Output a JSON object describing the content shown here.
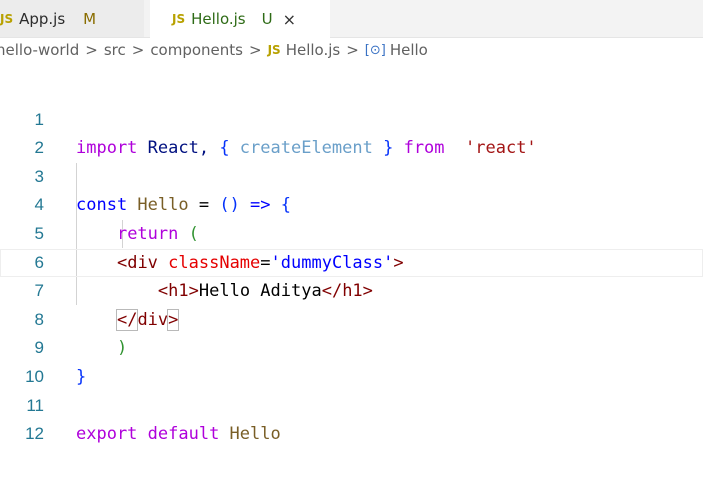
{
  "tabs": [
    {
      "label": "App.js",
      "badge": "JS",
      "status": "M"
    },
    {
      "label": "Hello.js",
      "badge": "JS",
      "status": "U",
      "close": "×"
    }
  ],
  "breadcrumb": {
    "items": [
      "hello-world",
      "src",
      "components"
    ],
    "file_badge": "JS",
    "file": "Hello.js",
    "symbol_icon": "[⊙]",
    "symbol": "Hello",
    "separator": ">"
  },
  "editor": {
    "line_numbers": [
      "1",
      "2",
      "3",
      "4",
      "5",
      "6",
      "7",
      "8",
      "9",
      "10",
      "11",
      "12"
    ],
    "code": {
      "l1": {
        "import": "import",
        "react_id": " React, ",
        "brace_open": "{",
        "create": " createElement ",
        "brace_close": "}",
        "from": " from ",
        "str": "'react'"
      },
      "l3": {
        "const": "const",
        "name": " Hello",
        "eq": " = ",
        "paren": "()",
        "arrow": " => ",
        "brace": "{"
      },
      "l4": {
        "ret": "return",
        "paren": " ("
      },
      "l5": {
        "lt": "<",
        "tag": "div",
        "attr": " className",
        "eq": "=",
        "str": "'dummyClass'",
        "gt": ">"
      },
      "l6": {
        "lt": "<",
        "tag": "h1",
        "gt": ">",
        "text": "Hello Aditya",
        "close_lt": "</",
        "close_tag": "h1",
        "close_gt": ">"
      },
      "l7": {
        "lt": "</",
        "tag": "div",
        "gt": ">"
      },
      "l8": {
        "paren": ")"
      },
      "l9": {
        "brace": "}"
      },
      "l11": {
        "export": "export",
        "default": " default",
        "name": " Hello"
      }
    }
  }
}
